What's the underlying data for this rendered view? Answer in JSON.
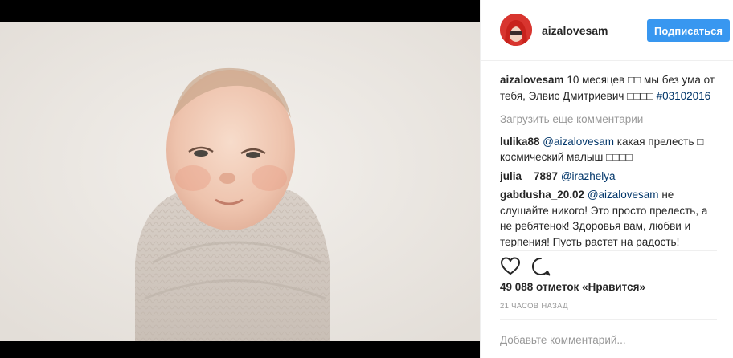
{
  "post": {
    "username": "aizalovesam",
    "follow_label": "Подписаться",
    "caption": {
      "user": "aizalovesam",
      "text": " 10 месяцев □□ мы без ума от тебя, Элвис Дмитриевич □□□□ ",
      "hashtag": "#03102016"
    },
    "load_more_label": "Загрузить еще комментарии",
    "comments": [
      {
        "user": "lulika88",
        "mention": "@aizalovesam",
        "text": " какая прелесть □ космический малыш □□□□"
      },
      {
        "user": "julia__7887",
        "mention": "@irazhelya",
        "text": ""
      },
      {
        "user": "gabdusha_20.02",
        "mention": "@aizalovesam",
        "text": " не слушайте никого! Это просто прелесть, а не ребятенок! Здоровья вам, любви и терпения! Пусть растет на радость!"
      }
    ],
    "likes_text": "49 088 отметок «Нравится»",
    "time_text": "21 ЧАСОВ НАЗАД",
    "add_comment_placeholder": "Добавьте комментарий...",
    "icons": {
      "like": "heart-outline-icon",
      "comment": "speech-bubble-icon"
    },
    "colors": {
      "accent": "#3897f0",
      "link": "#003569",
      "muted": "#999999"
    }
  }
}
